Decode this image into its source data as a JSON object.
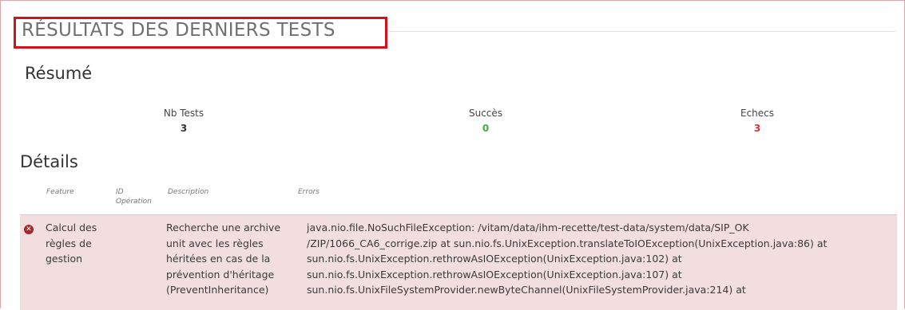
{
  "page": {
    "title": "RÉSULTATS DES DERNIERS TESTS"
  },
  "summary": {
    "heading": "Résumé",
    "nb_tests_label": "Nb Tests",
    "nb_tests_value": "3",
    "success_label": "Succès",
    "success_value": "0",
    "failures_label": "Echecs",
    "failures_value": "3",
    "colors": {
      "success": "#3fae49",
      "failure": "#d9343a"
    }
  },
  "details": {
    "heading": "Détails",
    "columns": [
      "Feature",
      "ID Opération",
      "Description",
      "Errors"
    ],
    "column_id_line1": "ID",
    "column_id_line2": "Opération",
    "rows": [
      {
        "status_icon": "error-circle-icon",
        "feature_lines": [
          "Calcul des",
          "règles de",
          "gestion"
        ],
        "id_operation": "",
        "description_lines": [
          "Recherche une archive",
          "unit avec les règles",
          "héritées en cas de la",
          "prévention d'héritage",
          "(PreventInheritance)"
        ],
        "errors_lines": [
          "java.nio.file.NoSuchFileException: /vitam/data/ihm-recette/test-data/system/data/SIP_OK",
          "/ZIP/1066_CA6_corrige.zip at sun.nio.fs.UnixException.translateToIOException(UnixException.java:86) at",
          "sun.nio.fs.UnixException.rethrowAsIOException(UnixException.java:102) at",
          "sun.nio.fs.UnixException.rethrowAsIOException(UnixException.java:107) at",
          "sun.nio.fs.UnixFileSystemProvider.newByteChannel(UnixFileSystemProvider.java:214) at"
        ]
      }
    ]
  }
}
